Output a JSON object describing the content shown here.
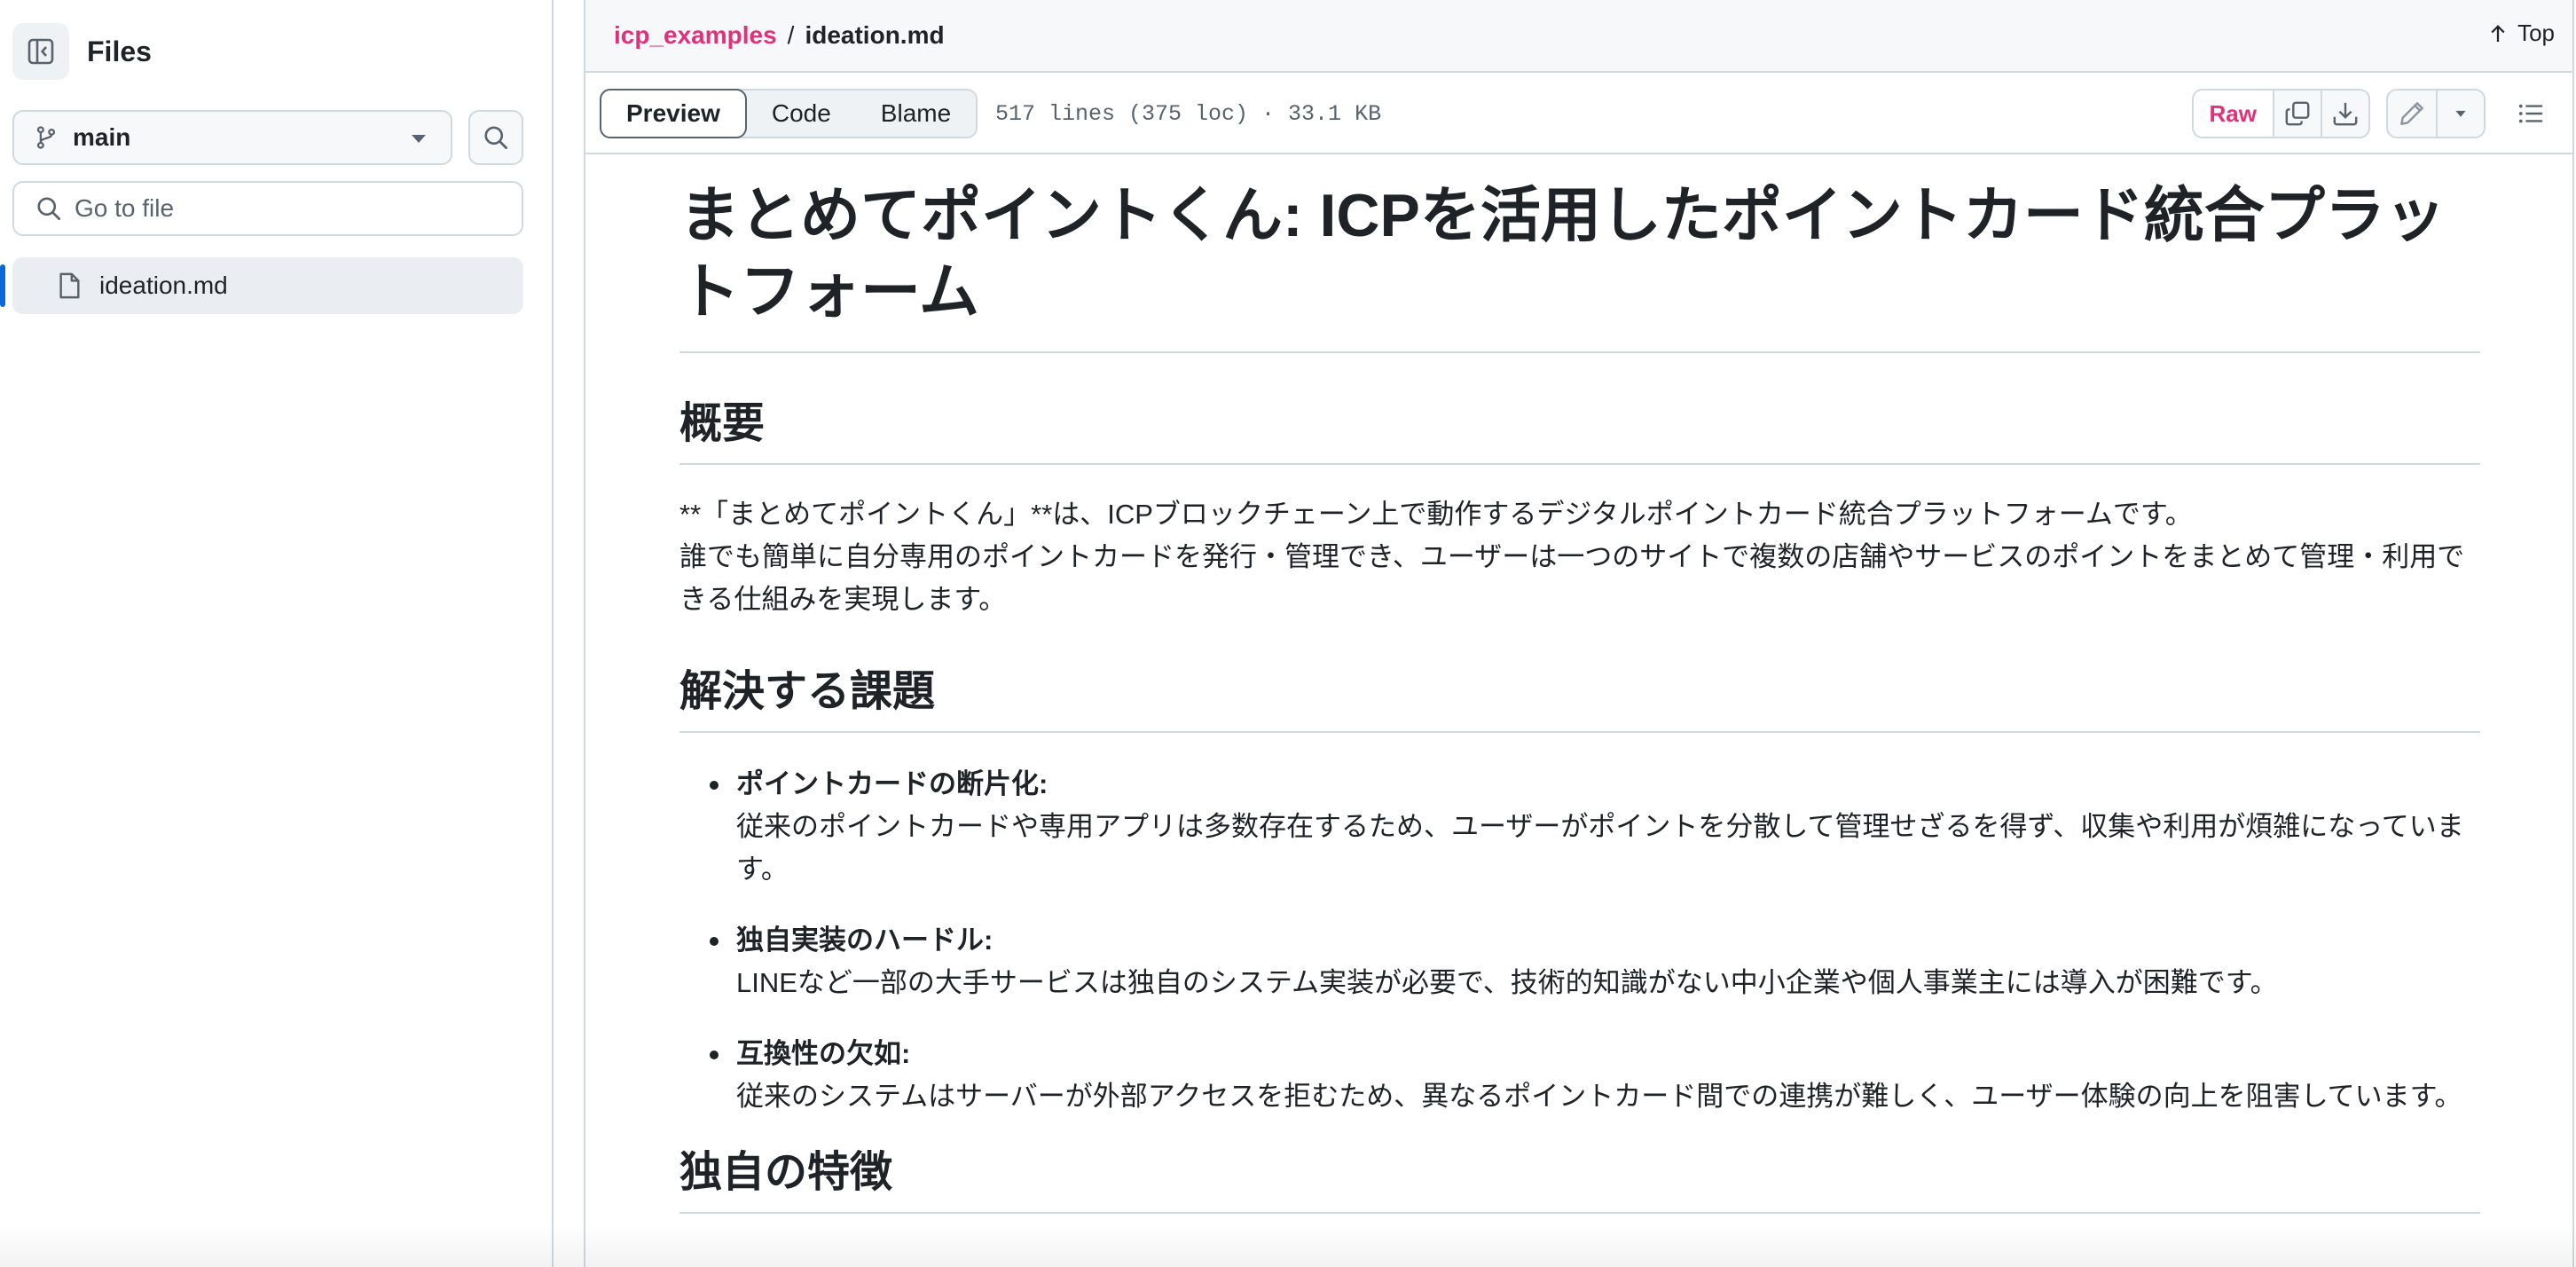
{
  "sidebar": {
    "title": "Files",
    "branch": "main",
    "goto_placeholder": "Go to file",
    "files": [
      {
        "name": "ideation.md",
        "active": true
      }
    ]
  },
  "breadcrumb": {
    "repo": "icp_examples",
    "sep": "/",
    "file": "ideation.md"
  },
  "top_link": "Top",
  "toolbar": {
    "tabs": [
      "Preview",
      "Code",
      "Blame"
    ],
    "active_tab": "Preview",
    "meta": "517 lines (375 loc) · 33.1 KB",
    "raw_label": "Raw"
  },
  "doc": {
    "title": "まとめてポイントくん: ICPを活用したポイントカード統合プラットフォーム",
    "h2_overview": "概要",
    "overview_p1": "**「まとめてポイントくん」**は、ICPブロックチェーン上で動作するデジタルポイントカード統合プラットフォームです。",
    "overview_p2": "誰でも簡単に自分専用のポイントカードを発行・管理でき、ユーザーは一つのサイトで複数の店舗やサービスのポイントをまとめて管理・利用できる仕組みを実現します。",
    "h2_problems": "解決する課題",
    "problems": [
      {
        "title": "ポイントカードの断片化:",
        "text": "従来のポイントカードや専用アプリは多数存在するため、ユーザーがポイントを分散して管理せざるを得ず、収集や利用が煩雑になっています。"
      },
      {
        "title": "独自実装のハードル:",
        "text": "LINEなど一部の大手サービスは独自のシステム実装が必要で、技術的知識がない中小企業や個人事業主には導入が困難です。"
      },
      {
        "title": "互換性の欠如:",
        "text": "従来のシステムはサーバーが外部アクセスを拒むため、異なるポイントカード間での連携が難しく、ユーザー体験の向上を阻害しています。"
      }
    ],
    "h2_features": "独自の特徴"
  },
  "colors": {
    "accent": "#e0317a",
    "active_marker": "#0969da",
    "border": "#d1d9e0",
    "text": "#1f2328",
    "muted": "#59636e"
  }
}
